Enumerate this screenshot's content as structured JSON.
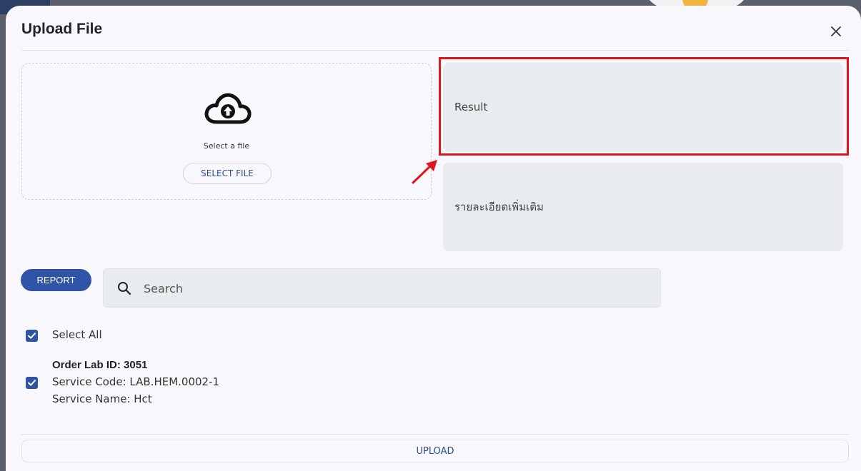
{
  "dialog": {
    "title": "Upload File",
    "close_icon": "close-icon"
  },
  "dropzone": {
    "icon": "cloud-upload-icon",
    "text": "Select a file",
    "button_label": "SELECT FILE"
  },
  "fields": {
    "result_placeholder": "Result",
    "detail_placeholder": "รายละเอียดเพิ่มเติม"
  },
  "toolbar": {
    "report_label": "REPORT",
    "search_icon": "search-icon",
    "search_placeholder": "Search"
  },
  "selection": {
    "select_all_label": "Select All",
    "select_all_checked": true
  },
  "orders": [
    {
      "title": "Order Lab ID: 3051",
      "service_code": "Service Code: LAB.HEM.0002-1",
      "service_name": "Service Name: Hct",
      "checked": true
    }
  ],
  "footer": {
    "upload_label": "UPLOAD"
  },
  "colors": {
    "accent": "#2f54a5",
    "highlight": "#e0141c",
    "field_bg": "#e9ecef",
    "dialog_bg": "#f8f8fc"
  }
}
